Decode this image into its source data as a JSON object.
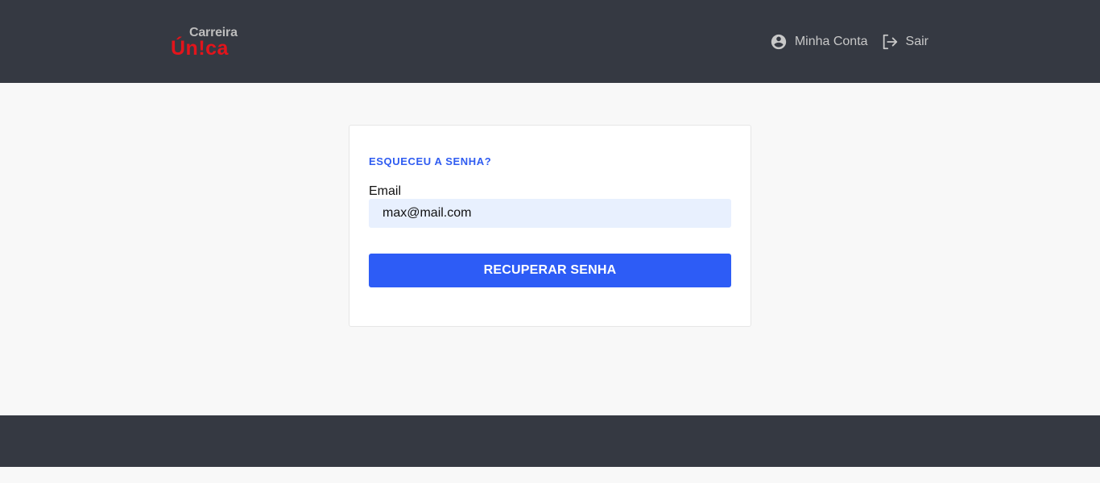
{
  "header": {
    "logo": {
      "top_text": "Carreira",
      "bottom_text": "Ún!ca"
    },
    "nav": {
      "account_label": "Minha Conta",
      "account_icon": "account-circle-icon",
      "logout_label": "Sair",
      "logout_icon": "logout-icon"
    }
  },
  "form": {
    "title": "ESQUECEU A SENHA?",
    "email_label": "Email",
    "email_value": "max@mail.com",
    "submit_label": "RECUPERAR SENHA"
  },
  "colors": {
    "header_bg": "#353942",
    "accent": "#2d5cf6",
    "logo_red": "#e3141b",
    "input_bg": "#e8f0fe"
  }
}
